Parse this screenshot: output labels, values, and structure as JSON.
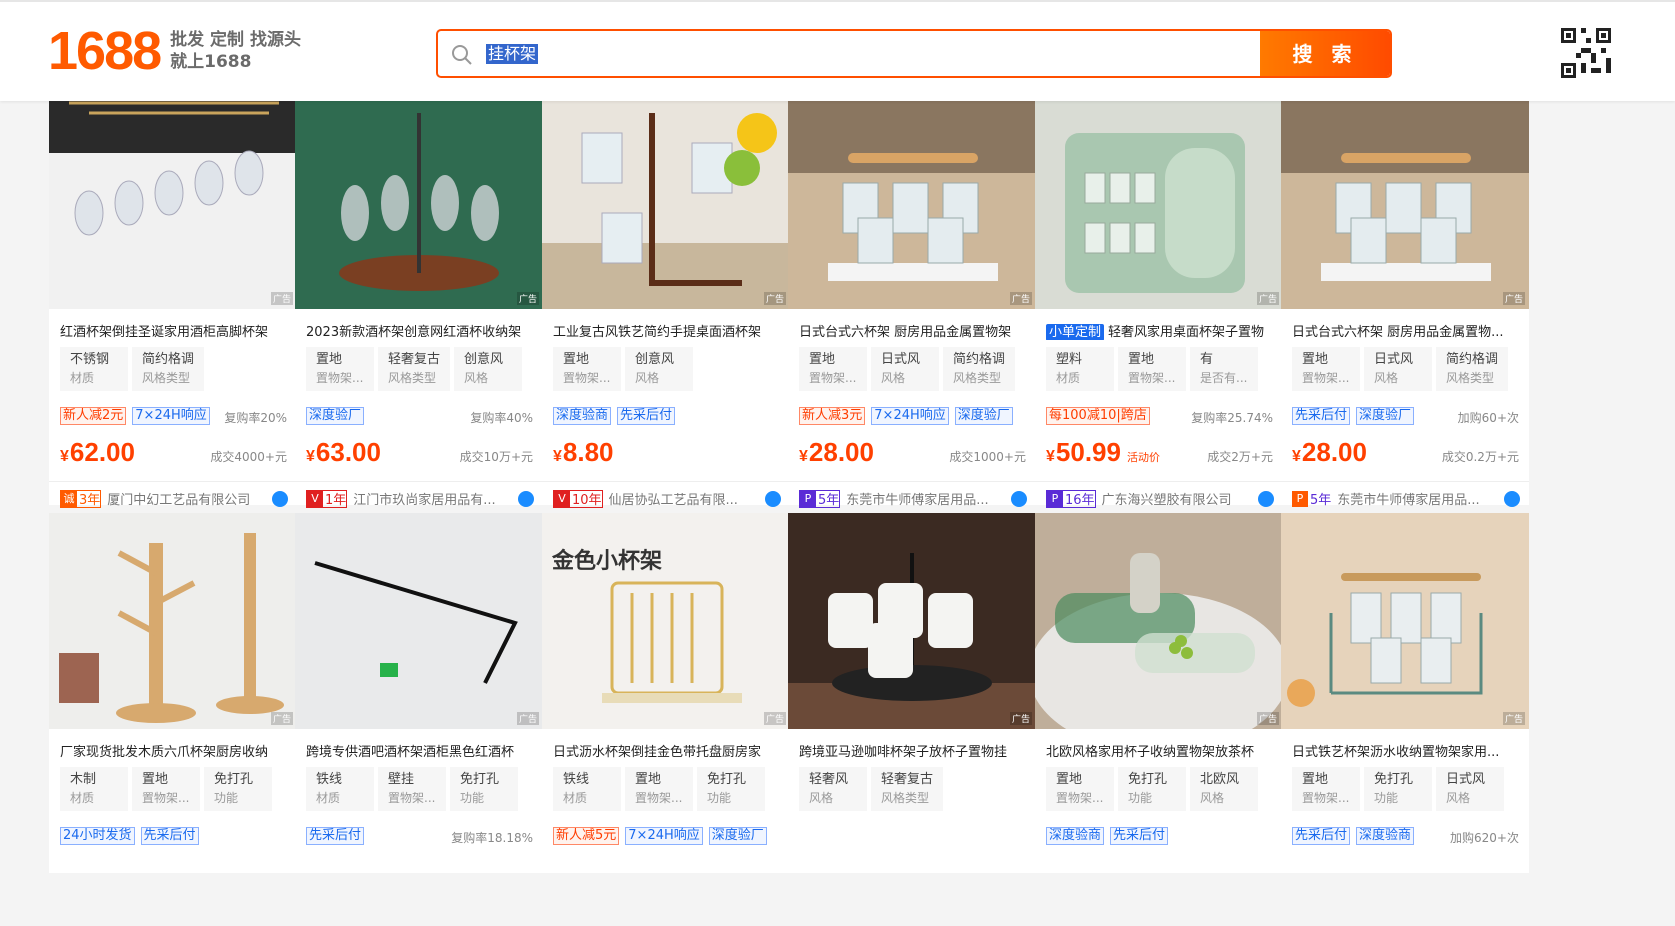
{
  "header": {
    "logo": "1688",
    "slogan_line1": "批发 定制 找源头",
    "slogan_line2": "就上1688",
    "search_value": "挂杯架",
    "search_button": "搜 索"
  },
  "colors": {
    "brand": "#ff5a00",
    "price": "#ff4000",
    "link_blue": "#1a6aee"
  },
  "ad_label": "广告",
  "products": [
    {
      "title": "红酒杯架倒挂圣诞家用酒柜高脚杯架",
      "title_tag": "",
      "attrs": [
        {
          "v": "不锈钢",
          "k": "材质"
        },
        {
          "v": "简约格调",
          "k": "风格类型"
        }
      ],
      "tags": [
        {
          "t": "新人减2元",
          "c": "red"
        },
        {
          "t": "7×24H响应",
          "c": "blue"
        }
      ],
      "repurchase": "复购率20%",
      "price": "62.00",
      "price_note": "",
      "deal": "成交4000+元",
      "badge": {
        "icon": "诚",
        "years": "3年",
        "style": "orange"
      },
      "seller": "厦门中幻工艺品有限公司"
    },
    {
      "title": "2023新款酒杯架创意网红酒杯收纳架",
      "title_tag": "",
      "attrs": [
        {
          "v": "置地",
          "k": "置物架..."
        },
        {
          "v": "轻奢复古",
          "k": "风格类型"
        },
        {
          "v": "创意风",
          "k": "风格"
        }
      ],
      "tags": [
        {
          "t": "深度验厂",
          "c": "blue"
        }
      ],
      "repurchase": "复购率40%",
      "price": "63.00",
      "price_note": "",
      "deal": "成交10万+元",
      "badge": {
        "icon": "V",
        "years": "1年",
        "style": "red"
      },
      "seller": "江门市玖尚家居用品有..."
    },
    {
      "title": "工业复古风铁艺简约手提桌面酒杯架",
      "title_tag": "",
      "attrs": [
        {
          "v": "置地",
          "k": "置物架..."
        },
        {
          "v": "创意风",
          "k": "风格"
        }
      ],
      "tags": [
        {
          "t": "深度验商",
          "c": "blue"
        },
        {
          "t": "先采后付",
          "c": "blue"
        }
      ],
      "repurchase": "",
      "price": "8.80",
      "price_note": "",
      "deal": "",
      "badge": {
        "icon": "V",
        "years": "10年",
        "style": "red"
      },
      "seller": "仙居协弘工艺品有限..."
    },
    {
      "title": "日式台式六杯架 厨房用品金属置物架",
      "title_tag": "",
      "attrs": [
        {
          "v": "置地",
          "k": "置物架..."
        },
        {
          "v": "日式风",
          "k": "风格"
        },
        {
          "v": "简约格调",
          "k": "风格类型"
        }
      ],
      "tags": [
        {
          "t": "新人减3元",
          "c": "red"
        },
        {
          "t": "7×24H响应",
          "c": "blue"
        },
        {
          "t": "深度验厂",
          "c": "blue"
        }
      ],
      "repurchase": "",
      "price": "28.00",
      "price_note": "",
      "deal": "成交1000+元",
      "badge": {
        "icon": "P",
        "years": "5年",
        "style": "purple"
      },
      "seller": "东莞市牛师傅家居用品..."
    },
    {
      "title": "轻奢风家用桌面杯架子置物",
      "title_tag": "小单定制",
      "attrs": [
        {
          "v": "塑料",
          "k": "材质"
        },
        {
          "v": "置地",
          "k": "置物架..."
        },
        {
          "v": "有",
          "k": "是否有..."
        }
      ],
      "tags": [
        {
          "t": "每100减10|跨店",
          "c": "red"
        }
      ],
      "repurchase": "复购率25.74%",
      "price": "50.99",
      "price_note": "活动价",
      "deal": "成交2万+元",
      "badge": {
        "icon": "P",
        "years": "16年",
        "style": "purple"
      },
      "seller": "广东海兴塑胶有限公司"
    },
    {
      "title": "日式台式六杯架 厨房用品金属置物...",
      "title_tag": "",
      "attrs": [
        {
          "v": "置地",
          "k": "置物架..."
        },
        {
          "v": "日式风",
          "k": "风格"
        },
        {
          "v": "简约格调",
          "k": "风格类型"
        }
      ],
      "tags": [
        {
          "t": "先采后付",
          "c": "blue"
        },
        {
          "t": "深度验厂",
          "c": "blue"
        }
      ],
      "repurchase": "加购60+次",
      "price": "28.00",
      "price_note": "",
      "deal": "成交0.2万+元",
      "badge": {
        "icon": "P",
        "years": "5年",
        "style": "plain"
      },
      "seller": "东莞市牛师傅家居用品..."
    },
    {
      "title": "厂家现货批发木质六爪杯架厨房收纳",
      "title_tag": "",
      "attrs": [
        {
          "v": "木制",
          "k": "材质"
        },
        {
          "v": "置地",
          "k": "置物架..."
        },
        {
          "v": "免打孔",
          "k": "功能"
        }
      ],
      "tags": [
        {
          "t": "24小时发货",
          "c": "blue"
        },
        {
          "t": "先采后付",
          "c": "blue"
        }
      ],
      "repurchase": "",
      "price": "",
      "price_note": "",
      "deal": "",
      "badge": null,
      "seller": ""
    },
    {
      "title": "跨境专供酒吧酒杯架酒柜黑色红酒杯",
      "title_tag": "",
      "attrs": [
        {
          "v": "铁线",
          "k": "材质"
        },
        {
          "v": "壁挂",
          "k": "置物架..."
        },
        {
          "v": "免打孔",
          "k": "功能"
        }
      ],
      "tags": [
        {
          "t": "先采后付",
          "c": "blue"
        }
      ],
      "repurchase": "复购率18.18%",
      "price": "",
      "price_note": "",
      "deal": "",
      "badge": null,
      "seller": ""
    },
    {
      "title": "日式沥水杯架倒挂金色带托盘厨房家",
      "title_tag": "",
      "attrs": [
        {
          "v": "铁线",
          "k": "材质"
        },
        {
          "v": "置地",
          "k": "置物架..."
        },
        {
          "v": "免打孔",
          "k": "功能"
        }
      ],
      "tags": [
        {
          "t": "新人减5元",
          "c": "red"
        },
        {
          "t": "7×24H响应",
          "c": "blue"
        },
        {
          "t": "深度验厂",
          "c": "blue"
        }
      ],
      "repurchase": "",
      "price": "",
      "price_note": "",
      "deal": "",
      "badge": null,
      "seller": "",
      "image_text": "金色小杯架"
    },
    {
      "title": "跨境亚马逊咖啡杯架子放杯子置物挂",
      "title_tag": "",
      "attrs": [
        {
          "v": "轻奢风",
          "k": "风格"
        },
        {
          "v": "轻奢复古",
          "k": "风格类型"
        }
      ],
      "tags": [],
      "repurchase": "",
      "price": "",
      "price_note": "",
      "deal": "",
      "badge": null,
      "seller": ""
    },
    {
      "title": "北欧风格家用杯子收纳置物架放茶杯",
      "title_tag": "",
      "attrs": [
        {
          "v": "置地",
          "k": "置物架..."
        },
        {
          "v": "免打孔",
          "k": "功能"
        },
        {
          "v": "北欧风",
          "k": "风格"
        }
      ],
      "tags": [
        {
          "t": "深度验商",
          "c": "blue"
        },
        {
          "t": "先采后付",
          "c": "blue"
        }
      ],
      "repurchase": "",
      "price": "",
      "price_note": "",
      "deal": "",
      "badge": null,
      "seller": ""
    },
    {
      "title": "日式铁艺杯架沥水收纳置物架家用...",
      "title_tag": "",
      "attrs": [
        {
          "v": "置地",
          "k": "置物架..."
        },
        {
          "v": "免打孔",
          "k": "功能"
        },
        {
          "v": "日式风",
          "k": "风格"
        }
      ],
      "tags": [
        {
          "t": "先采后付",
          "c": "blue"
        },
        {
          "t": "深度验商",
          "c": "blue"
        }
      ],
      "repurchase": "加购620+次",
      "price": "",
      "price_note": "",
      "deal": "",
      "badge": null,
      "seller": ""
    }
  ]
}
